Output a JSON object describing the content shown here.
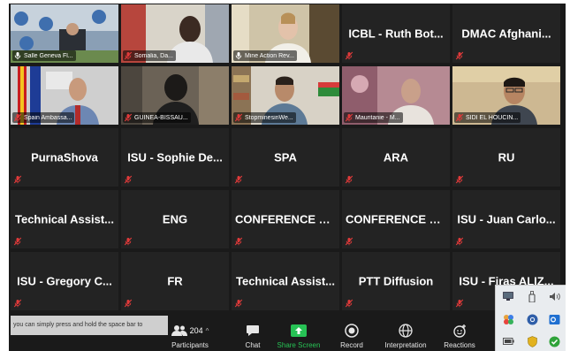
{
  "tiles": [
    {
      "label": "Salle Geneva Fl...",
      "video": true,
      "muted": false,
      "scene": "room"
    },
    {
      "label": "Somalia, Da...",
      "video": true,
      "muted": true,
      "scene": "person-dark"
    },
    {
      "label": "Mine Action Rev...",
      "video": true,
      "muted": false,
      "speaking": true,
      "scene": "person-light"
    },
    {
      "label": "ICBL - Ruth Bot...",
      "video": false,
      "muted": true
    },
    {
      "label": "DMAC Afghani...",
      "video": false,
      "muted": true
    },
    {
      "label": "Spain Ambassa...",
      "video": true,
      "muted": true,
      "scene": "flags"
    },
    {
      "label": "GUINEA-BISSAU...",
      "video": true,
      "muted": true,
      "scene": "person-back"
    },
    {
      "label": "StopminesinWe...",
      "video": true,
      "muted": true,
      "scene": "person-shelf"
    },
    {
      "label": "Mauritanie - M...",
      "video": true,
      "muted": true,
      "scene": "person-pink"
    },
    {
      "label": "SIDI EL HOUCIN...",
      "video": true,
      "muted": true,
      "scene": "person-glasses"
    },
    {
      "label": "PurnaShova",
      "video": false,
      "muted": true
    },
    {
      "label": "ISU - Sophie De...",
      "video": false,
      "muted": true
    },
    {
      "label": "SPA",
      "video": false,
      "muted": true
    },
    {
      "label": "ARA",
      "video": false,
      "muted": true
    },
    {
      "label": "RU",
      "video": false,
      "muted": true
    },
    {
      "label": "Technical Assist...",
      "video": false,
      "muted": true
    },
    {
      "label": "ENG",
      "video": false,
      "muted": true
    },
    {
      "label": "CONFERENCE R...",
      "video": false,
      "muted": true
    },
    {
      "label": "CONFERENCE R...",
      "video": false,
      "muted": true
    },
    {
      "label": "ISU - Juan Carlo...",
      "video": false,
      "muted": true
    },
    {
      "label": "ISU - Gregory C...",
      "video": false,
      "muted": true
    },
    {
      "label": "FR",
      "video": false,
      "muted": true
    },
    {
      "label": "Technical Assist...",
      "video": false,
      "muted": true
    },
    {
      "label": "PTT Diffusion",
      "video": false,
      "muted": true
    },
    {
      "label": "ISU - Firas ALIZ...",
      "video": false,
      "muted": true
    }
  ],
  "toolbar": {
    "tooltip": "you can simply press and hold the space bar to",
    "participants_count": "204",
    "participants_label": "Participants",
    "chat_label": "Chat",
    "share_label": "Share Screen",
    "record_label": "Record",
    "interpretation_label": "Interpretation",
    "reactions_label": "Reactions"
  },
  "tray_icons": [
    "monitor-icon",
    "usb-drive-icon",
    "speaker-icon",
    "zoom-app-icon",
    "chrome-icon",
    "outlook-icon",
    "battery-icon",
    "shield-icon",
    "check-icon"
  ],
  "colors": {
    "mute": "#e03a3a",
    "share": "#27c255",
    "speaking": "#b6e34a"
  }
}
